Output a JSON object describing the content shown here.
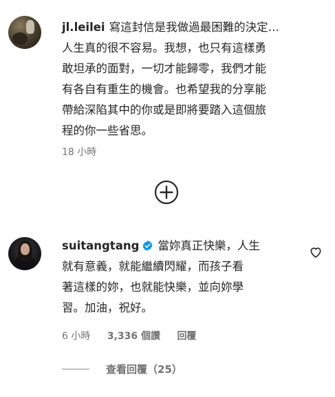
{
  "comments": [
    {
      "username": "jl.leilei",
      "first_line": "寫這封信是我做過最困難的決定…",
      "lines": [
        "人生真的很不容易。我想，也只有這樣勇",
        "敢坦承的面對，一切才能歸零，我們才能",
        "有各自有重生的機會。也希望我的分享能",
        "帶給深陷其中的你或是即將要踏入這個旅",
        "程的你一些省思。"
      ],
      "time": "18 小時"
    },
    {
      "username": "suitangtang",
      "verified": true,
      "first_line": "當妳真正快樂，人生",
      "lines": [
        "就有意義，就能繼續閃耀，而孩子看",
        "著這樣的妳，也就能快樂，並向妳學",
        "習。加油，祝好。"
      ],
      "time": "6 小時",
      "likes": "3,336 個讚",
      "reply": "回覆",
      "view_replies": "查看回覆（25）"
    }
  ],
  "icons": {
    "expand": "plus-circle-icon",
    "like": "heart-outline-icon",
    "verified": "verified-badge-icon"
  },
  "colors": {
    "text": "#262626",
    "secondary": "#737373",
    "verified": "#0095f6"
  }
}
